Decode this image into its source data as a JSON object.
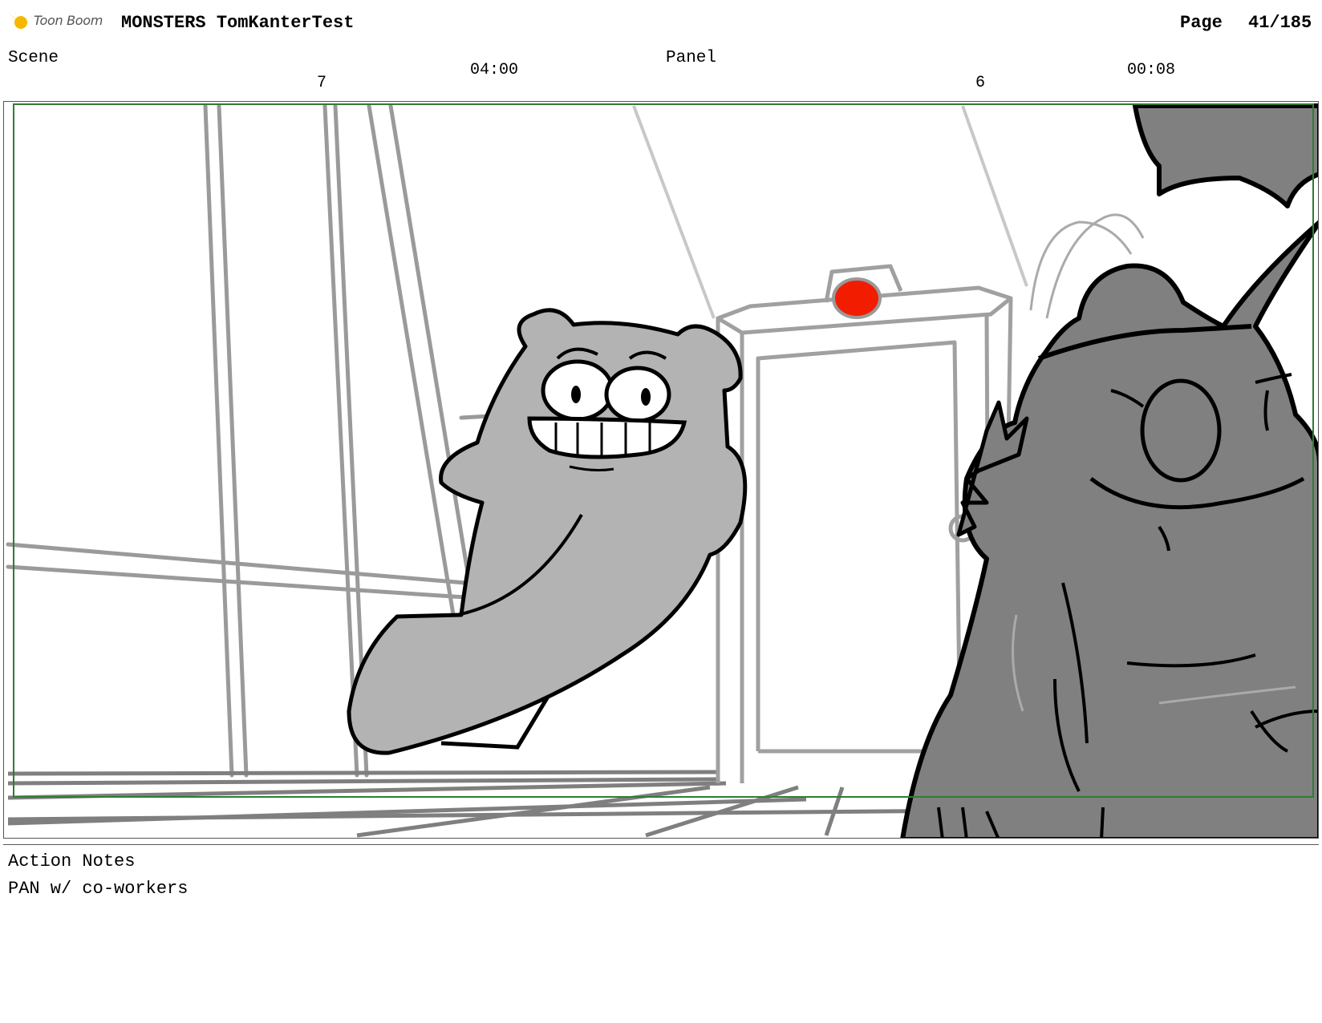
{
  "header": {
    "brand": "Toon Boom",
    "project_title": "MONSTERS TomKanterTest",
    "page_label": "Page",
    "page_value": "41/185"
  },
  "scene": {
    "label": "Scene",
    "number": "7",
    "duration": "04:00"
  },
  "panel": {
    "label": "Panel",
    "number": "6",
    "duration": "00:08"
  },
  "notes": {
    "label": "Action Notes",
    "text": "PAN w/ co-workers"
  },
  "colors": {
    "safe_frame": "#2e7d32",
    "alarm_light": "#f21d00",
    "monster_light": "#b3b3b3",
    "monster_dark": "#808080"
  }
}
